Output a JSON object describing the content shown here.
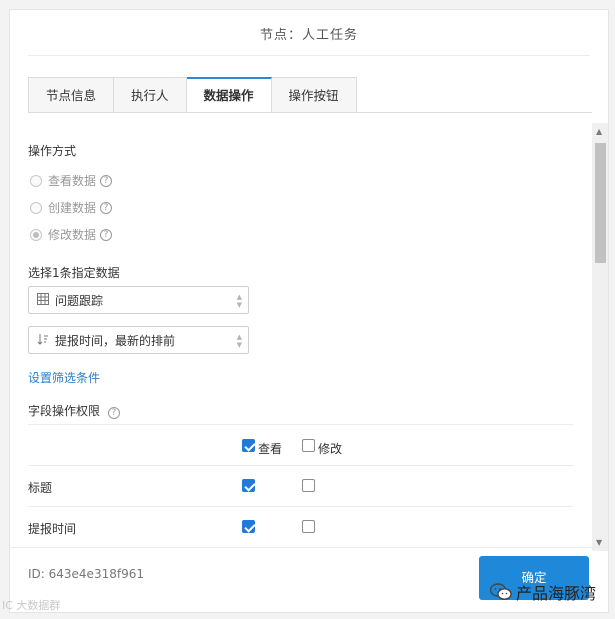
{
  "dialog": {
    "title": "节点：人工任务"
  },
  "tabs": [
    {
      "label": "节点信息",
      "active": false
    },
    {
      "label": "执行人",
      "active": false
    },
    {
      "label": "数据操作",
      "active": true
    },
    {
      "label": "操作按钮",
      "active": false
    }
  ],
  "operation": {
    "label": "操作方式",
    "options": [
      {
        "label": "查看数据",
        "selected": false
      },
      {
        "label": "创建数据",
        "selected": false
      },
      {
        "label": "修改数据",
        "selected": true
      }
    ]
  },
  "data_select": {
    "label": "选择1条指定数据",
    "table_value": "问题跟踪",
    "sort_value": "提报时间，最新的排前",
    "filter_link": "设置筛选条件"
  },
  "permissions": {
    "label": "字段操作权限",
    "header": {
      "view": "查看",
      "edit": "修改",
      "view_checked": true,
      "edit_checked": false
    },
    "rows": [
      {
        "label": "标题",
        "view": true,
        "edit": false
      },
      {
        "label": "提报时间",
        "view": true,
        "edit": false
      }
    ]
  },
  "footer": {
    "id_text": "ID: 643e4e318f961",
    "confirm_label": "确定"
  },
  "overlay": {
    "wechat_label": "产品海豚湾",
    "watermark": "IC 大数据群"
  },
  "colors": {
    "accent": "#1f88d8",
    "link": "#2a7fc9",
    "checkbox": "#1f7ad9"
  },
  "icons": {
    "help": "question-circle-icon",
    "table": "table-grid-icon",
    "sort": "sort-icon"
  }
}
